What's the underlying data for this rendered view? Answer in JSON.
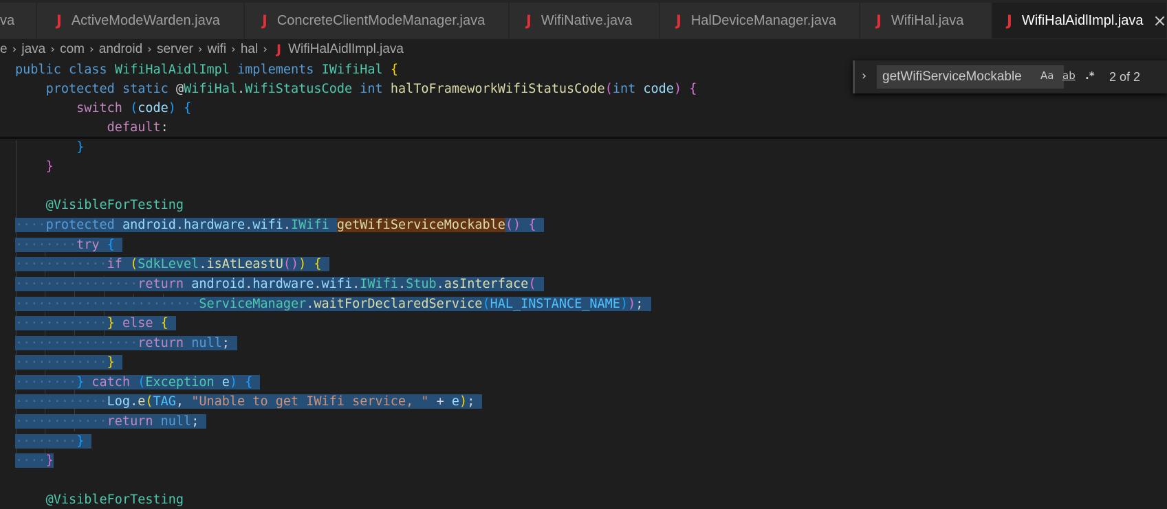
{
  "tabs": [
    {
      "label": "va",
      "active": false
    },
    {
      "label": "ActiveModeWarden.java",
      "active": false
    },
    {
      "label": "ConcreteClientModeManager.java",
      "active": false
    },
    {
      "label": "WifiNative.java",
      "active": false
    },
    {
      "label": "HalDeviceManager.java",
      "active": false
    },
    {
      "label": "WifiHal.java",
      "active": false
    },
    {
      "label": "WifiHalAidlImpl.java",
      "active": true
    }
  ],
  "file_icon": "J",
  "close_glyph": "×",
  "breadcrumb": {
    "items": [
      "e",
      "java",
      "com",
      "android",
      "server",
      "wifi",
      "hal"
    ],
    "file": "WifiHalAidlImpl.java",
    "separator": "›"
  },
  "find_widget": {
    "query": "getWifiServiceMockable",
    "match_case_label": "Aa",
    "whole_word_label": "ab",
    "regex_label": ".*",
    "result": "2 of 2"
  },
  "code": {
    "sticky_lines": [
      "public class WifiHalAidlImpl implements IWifiHal {",
      "    protected static @WifiHal.WifiStatusCode int halToFrameworkWifiStatusCode(int code) {",
      "        switch (code) {",
      "            default:"
    ],
    "lines": [
      "        }",
      "    }",
      "",
      "    @VisibleForTesting",
      "    protected android.hardware.wifi.IWifi getWifiServiceMockable() {",
      "        try {",
      "            if (SdkLevel.isAtLeastU()) {",
      "                return android.hardware.wifi.IWifi.Stub.asInterface(",
      "                        ServiceManager.waitForDeclaredService(HAL_INSTANCE_NAME));",
      "            } else {",
      "                return null;",
      "            }",
      "        } catch (Exception e) {",
      "            Log.e(TAG, \"Unable to get IWifi service, \" + e);",
      "            return null;",
      "        }",
      "    }",
      "",
      "    @VisibleForTesting"
    ]
  },
  "colors": {
    "background": "#1e1e1e",
    "selection": "#264f78",
    "find_match": "#623315",
    "java_icon": "#e0303a"
  }
}
